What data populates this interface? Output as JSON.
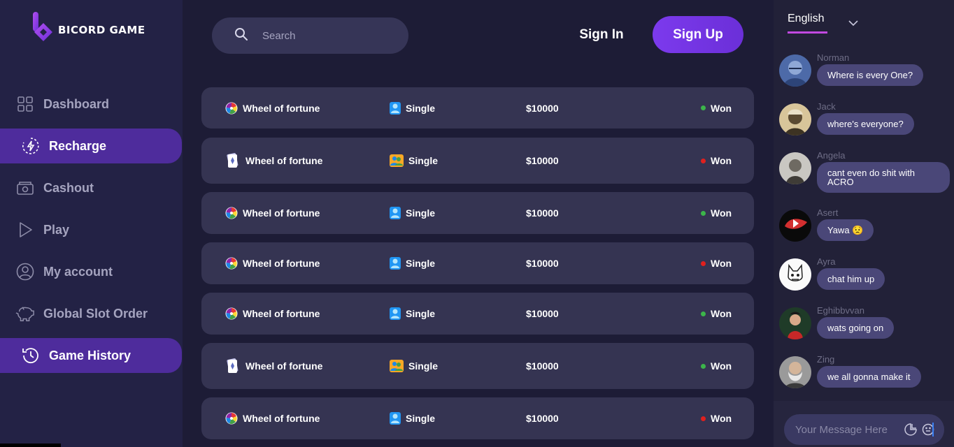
{
  "brand": {
    "name": "BICORD GAME"
  },
  "sidebar": {
    "items": [
      {
        "label": "Dashboard",
        "icon": "grid-icon",
        "active": false
      },
      {
        "label": "Recharge",
        "icon": "bolt-circle-icon",
        "active": true
      },
      {
        "label": "Cashout",
        "icon": "wallet-icon",
        "active": false
      },
      {
        "label": "Play",
        "icon": "play-icon",
        "active": false
      },
      {
        "label": "My account",
        "icon": "user-circle-icon",
        "active": false
      },
      {
        "label": "Global Slot Order",
        "icon": "piggy-bank-icon",
        "active": false
      },
      {
        "label": "Game History",
        "icon": "history-icon",
        "active": true
      }
    ]
  },
  "header": {
    "search_placeholder": "Search",
    "signin_label": "Sign In",
    "signup_label": "Sign Up"
  },
  "games": [
    {
      "name": "Wheel of fortune",
      "icon": "wheel-icon",
      "mode": "Single",
      "mode_icon": "single-player-icon",
      "amount": "$10000",
      "result": "Won",
      "status_color": "#3cb54a"
    },
    {
      "name": "Wheel of fortune",
      "icon": "card-icon",
      "mode": "Single",
      "mode_icon": "multi-player-icon",
      "amount": "$10000",
      "result": "Won",
      "status_color": "#e0201e"
    },
    {
      "name": "Wheel of fortune",
      "icon": "wheel-icon",
      "mode": "Single",
      "mode_icon": "single-player-icon",
      "amount": "$10000",
      "result": "Won",
      "status_color": "#3cb54a"
    },
    {
      "name": "Wheel of fortune",
      "icon": "wheel-icon",
      "mode": "Single",
      "mode_icon": "single-player-icon",
      "amount": "$10000",
      "result": "Won",
      "status_color": "#e0201e"
    },
    {
      "name": "Wheel of fortune",
      "icon": "wheel-icon",
      "mode": "Single",
      "mode_icon": "single-player-icon",
      "amount": "$10000",
      "result": "Won",
      "status_color": "#3cb54a"
    },
    {
      "name": "Wheel of fortune",
      "icon": "card-icon",
      "mode": "Single",
      "mode_icon": "multi-player-icon",
      "amount": "$10000",
      "result": "Won",
      "status_color": "#3cb54a"
    },
    {
      "name": "Wheel of fortune",
      "icon": "wheel-icon",
      "mode": "Single",
      "mode_icon": "single-player-icon",
      "amount": "$10000",
      "result": "Won",
      "status_color": "#e0201e"
    }
  ],
  "chat": {
    "language": "English",
    "messages": [
      {
        "user": "Norman",
        "text": "Where is every One?"
      },
      {
        "user": "Jack",
        "text": "where's everyone?"
      },
      {
        "user": "Angela",
        "text": "cant even do shit with ACRO"
      },
      {
        "user": "Asert",
        "text": "Yawa 😟"
      },
      {
        "user": "Ayra",
        "text": "chat him up"
      },
      {
        "user": "Eghibbvvan",
        "text": "wats going on"
      },
      {
        "user": "Zing",
        "text": "we all gonna make it"
      }
    ],
    "input_placeholder": "Your Message Here"
  },
  "colors": {
    "accent": "#7c3aed",
    "active_nav": "#4e2c9c",
    "won_green": "#3cb54a",
    "lost_red": "#e0201e"
  }
}
